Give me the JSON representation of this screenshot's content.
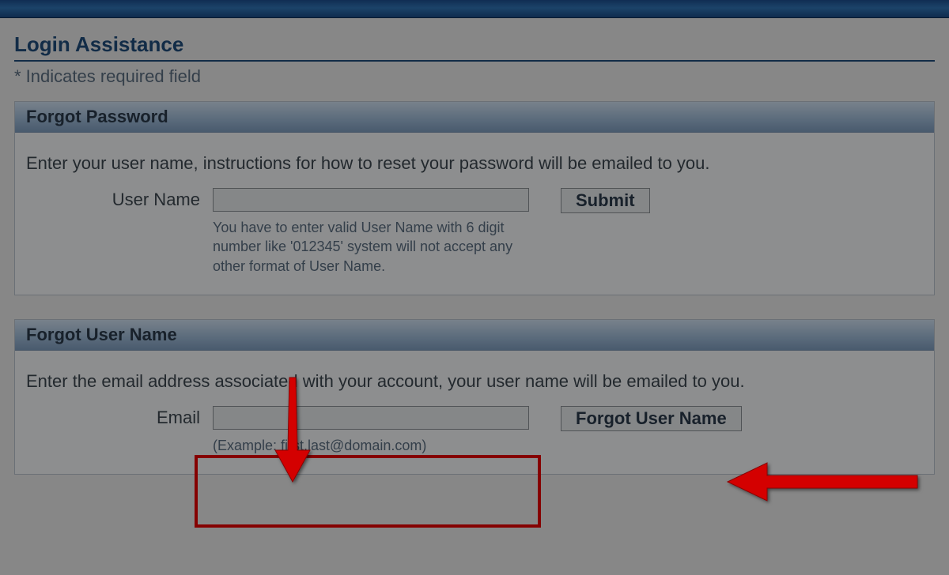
{
  "page": {
    "title": "Login Assistance",
    "required_note": "*  Indicates required field"
  },
  "forgot_password": {
    "header": "Forgot Password",
    "instruction": "Enter your user name, instructions for how to reset your password will be emailed to you.",
    "label": "User Name",
    "hint": "You have to enter valid User Name with 6 digit number like '012345' system will not accept any other format of User Name.",
    "submit": "Submit"
  },
  "forgot_username": {
    "header": "Forgot User Name",
    "instruction": "Enter the email address associated with your account, your user name will be emailed to you.",
    "label": "Email",
    "hint": "(Example: first.last@domain.com)",
    "submit": "Forgot User Name"
  }
}
